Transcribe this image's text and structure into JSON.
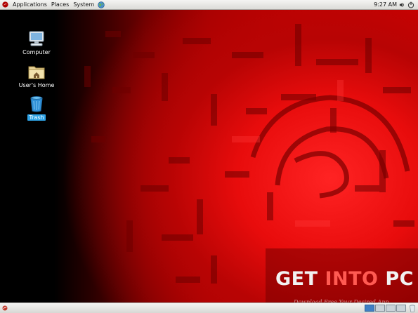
{
  "top_panel": {
    "menus": [
      "Applications",
      "Places",
      "System"
    ],
    "clock": "9:27 AM",
    "icons": [
      "fedora-logo-icon",
      "globe-icon",
      "volume-icon",
      "power-icon"
    ]
  },
  "desktop": {
    "icons": [
      {
        "label": "Computer",
        "icon": "computer-icon"
      },
      {
        "label": "User's Home",
        "icon": "home-folder-icon"
      },
      {
        "label": "Trash",
        "icon": "trash-icon"
      }
    ]
  },
  "watermark": {
    "get": "GET",
    "into": "INTO",
    "pc": "PC",
    "subtitle": "Download Free Your Desired App"
  },
  "bottom_panel": {
    "workspaces": 4,
    "active_workspace": 1,
    "icons": [
      "show-desktop-icon",
      "trash-icon"
    ]
  },
  "colors": {
    "wallpaper_red": "#d40000",
    "panel_bg": "#e6e6e2",
    "selection_blue": "#2fa4e7",
    "watermark_accent": "#ff5a52"
  }
}
